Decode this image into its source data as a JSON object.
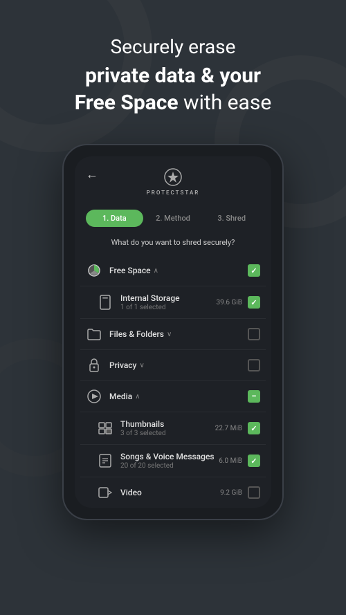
{
  "page": {
    "background_color": "#2d3339",
    "header": {
      "line1": "Securely erase",
      "line2": "private data & your",
      "line3_bold": "Free Space",
      "line3_rest": " with ease"
    },
    "phone": {
      "back_label": "←",
      "logo_text": "PROTECTSTAR",
      "steps": [
        {
          "label": "1. Data",
          "active": true
        },
        {
          "label": "2. Method",
          "active": false
        },
        {
          "label": "3. Shred",
          "active": false
        }
      ],
      "question": "What do you want to shred securely?",
      "items": [
        {
          "icon": "pie-chart-icon",
          "title": "Free Space",
          "chevron": "∧",
          "size": "",
          "subtitle": "",
          "checked": "checked",
          "indent": false
        },
        {
          "icon": "storage-icon",
          "title": "Internal Storage",
          "chevron": "",
          "size": "39.6 GiB",
          "subtitle": "1 of 1 selected",
          "checked": "checked",
          "indent": true
        },
        {
          "icon": "folder-icon",
          "title": "Files & Folders",
          "chevron": "∨",
          "size": "",
          "subtitle": "",
          "checked": "unchecked",
          "indent": false
        },
        {
          "icon": "lock-icon",
          "title": "Privacy",
          "chevron": "∨",
          "size": "",
          "subtitle": "",
          "checked": "unchecked",
          "indent": false
        },
        {
          "icon": "play-icon",
          "title": "Media",
          "chevron": "∧",
          "size": "",
          "subtitle": "",
          "checked": "minus",
          "indent": false
        },
        {
          "icon": "thumbnail-icon",
          "title": "Thumbnails",
          "chevron": "",
          "size": "22.7 MiB",
          "subtitle": "3 of 3 selected",
          "checked": "checked",
          "indent": true
        },
        {
          "icon": "music-icon",
          "title": "Songs & Voice Messages",
          "chevron": "",
          "size": "6.0 MiB",
          "subtitle": "20 of 20 selected",
          "checked": "checked",
          "indent": true
        },
        {
          "icon": "video-icon",
          "title": "Video",
          "chevron": "",
          "size": "9.2 GiB",
          "subtitle": "",
          "checked": "unchecked",
          "indent": true
        }
      ]
    }
  }
}
